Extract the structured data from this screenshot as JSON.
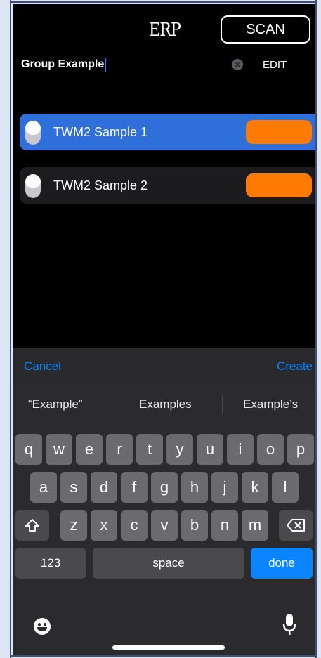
{
  "header": {
    "logo_text": "ERP",
    "scan_label": "SCAN"
  },
  "group": {
    "name": "Group Example",
    "edit_label": "EDIT"
  },
  "devices": [
    {
      "label": "TWM2 Sample 1",
      "selected": true,
      "color": "#ff7a00"
    },
    {
      "label": "TWM2 Sample 2",
      "selected": false,
      "color": "#ff7a00"
    }
  ],
  "toolbar": {
    "cancel_label": "Cancel",
    "create_label": "Create"
  },
  "keyboard": {
    "suggestions": [
      "“Example”",
      "Examples",
      "Example’s"
    ],
    "row1": [
      "q",
      "w",
      "e",
      "r",
      "t",
      "y",
      "u",
      "i",
      "o",
      "p"
    ],
    "row2": [
      "a",
      "s",
      "d",
      "f",
      "g",
      "h",
      "j",
      "k",
      "l"
    ],
    "row3": [
      "z",
      "x",
      "c",
      "v",
      "b",
      "n",
      "m"
    ],
    "numbers_label": "123",
    "space_label": "space",
    "done_label": "done",
    "shift_icon": "shift-icon",
    "delete_icon": "delete-icon",
    "emoji_icon": "emoji-icon",
    "mic_icon": "microphone-icon"
  },
  "colors": {
    "accent_blue": "#0a84ff",
    "selected_row": "#2f6fd9",
    "device_orange": "#ff7a00"
  }
}
